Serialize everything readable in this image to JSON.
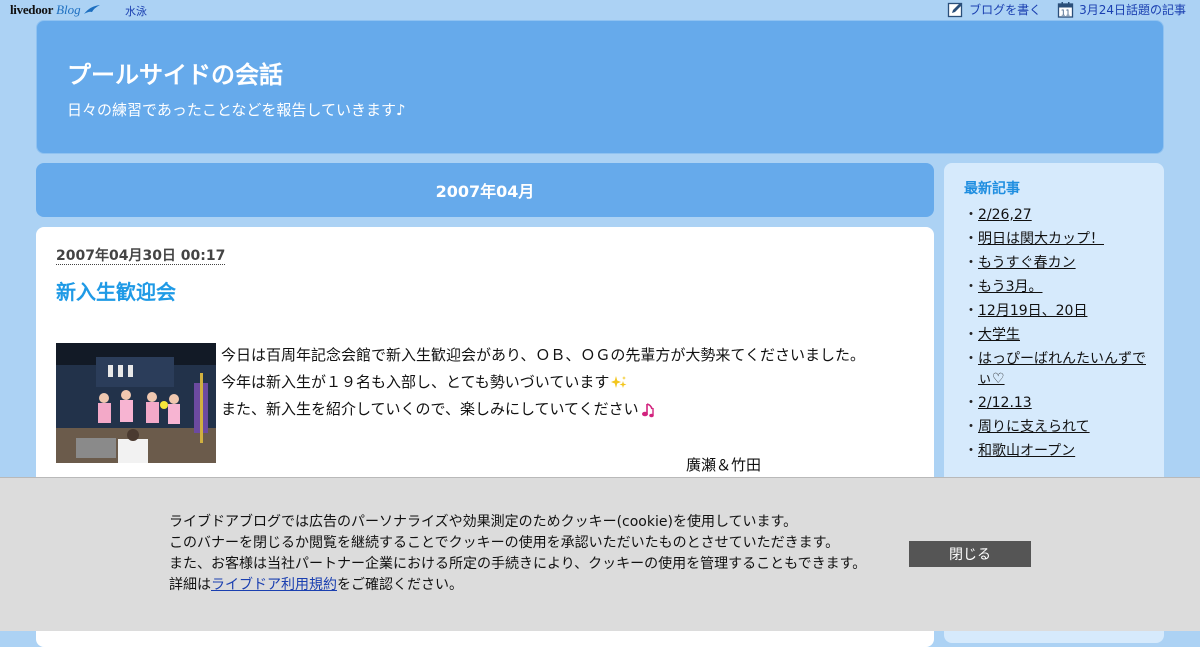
{
  "topbar": {
    "logo_live": "livedoor",
    "logo_blog": "Blog",
    "category": "水泳",
    "write_label": "ブログを書く",
    "calendar_day": "11",
    "topic_label": "3月24日話題の記事"
  },
  "header": {
    "title": "プールサイドの会話",
    "description": "日々の練習であったことなどを報告していきます♪"
  },
  "archive": {
    "month": "2007年04月"
  },
  "post": {
    "date": "2007年04月30日 00:17",
    "title": "新入生歓迎会",
    "body": [
      "今日は百周年記念会館で新入生歓迎会があり、ＯＢ、ＯＧの先輩方が大勢来てくださいました。",
      "今年は新入生が１９名も入部し、とても勢いづいています",
      "また、新入生を紹介していくので、楽しみにしていてください"
    ],
    "emoji": [
      "sparkle-emoji",
      "music-note-emoji"
    ],
    "signature": "廣瀬＆竹田"
  },
  "sidebar": {
    "title": "最新記事",
    "items": [
      {
        "label": "2/26,27"
      },
      {
        "label": "明日は関大カップ！"
      },
      {
        "label": "もうすぐ春カン"
      },
      {
        "label": "もう3月。"
      },
      {
        "label": "12月19日、20日"
      },
      {
        "label": "大学生"
      },
      {
        "label": "はっぴーばれんたいんずでぃ♡"
      },
      {
        "label": "2/12.13"
      },
      {
        "label": "周りに支えられて"
      },
      {
        "label": "和歌山オープン"
      }
    ]
  },
  "cookie": {
    "lines": [
      "ライブドアブログでは広告のパーソナライズや効果測定のためクッキー(cookie)を使用しています。",
      "このバナーを閉じるか閲覧を継続することでクッキーの使用を承認いただいたものとさせていただきます。",
      "また、お客様は当社パートナー企業における所定の手続きにより、クッキーの使用を管理することもできます。"
    ],
    "details_prefix": "詳細は",
    "terms_link": "ライブドア利用規約",
    "details_suffix": "をご確認ください。",
    "close_label": "閉じる"
  },
  "colors": {
    "page_bg": "#acd2f4",
    "header_bg": "#66aaeb",
    "sidebar_bg": "#d6eafc",
    "title_accent": "#1f9ae6",
    "link": "#1a3fb0",
    "cookie_bg": "#dcdcdc",
    "close_button": "#555555"
  }
}
